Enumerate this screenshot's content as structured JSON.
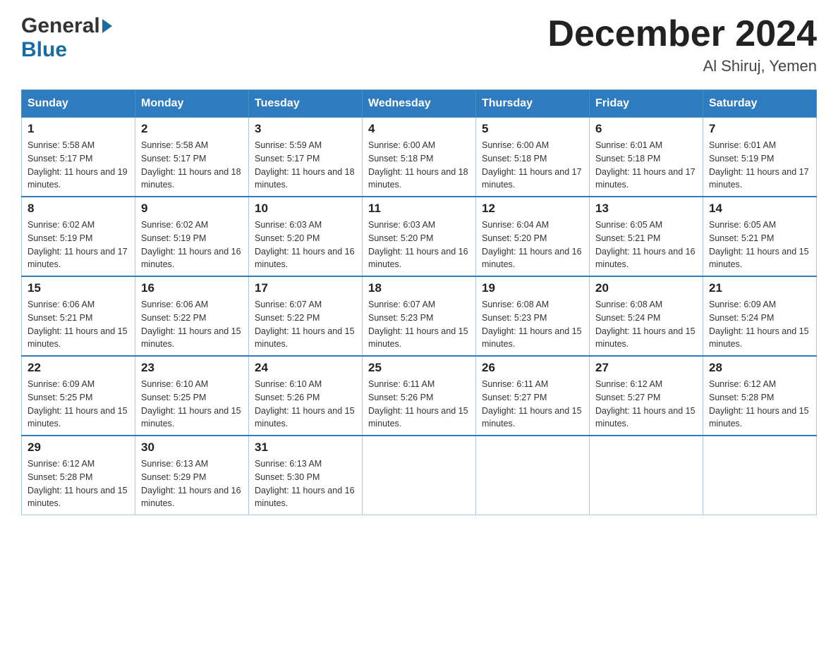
{
  "header": {
    "logo_general": "General",
    "logo_blue": "Blue",
    "title": "December 2024",
    "location": "Al Shiruj, Yemen"
  },
  "days_of_week": [
    "Sunday",
    "Monday",
    "Tuesday",
    "Wednesday",
    "Thursday",
    "Friday",
    "Saturday"
  ],
  "weeks": [
    [
      {
        "day": "1",
        "sunrise": "5:58 AM",
        "sunset": "5:17 PM",
        "daylight": "11 hours and 19 minutes."
      },
      {
        "day": "2",
        "sunrise": "5:58 AM",
        "sunset": "5:17 PM",
        "daylight": "11 hours and 18 minutes."
      },
      {
        "day": "3",
        "sunrise": "5:59 AM",
        "sunset": "5:17 PM",
        "daylight": "11 hours and 18 minutes."
      },
      {
        "day": "4",
        "sunrise": "6:00 AM",
        "sunset": "5:18 PM",
        "daylight": "11 hours and 18 minutes."
      },
      {
        "day": "5",
        "sunrise": "6:00 AM",
        "sunset": "5:18 PM",
        "daylight": "11 hours and 17 minutes."
      },
      {
        "day": "6",
        "sunrise": "6:01 AM",
        "sunset": "5:18 PM",
        "daylight": "11 hours and 17 minutes."
      },
      {
        "day": "7",
        "sunrise": "6:01 AM",
        "sunset": "5:19 PM",
        "daylight": "11 hours and 17 minutes."
      }
    ],
    [
      {
        "day": "8",
        "sunrise": "6:02 AM",
        "sunset": "5:19 PM",
        "daylight": "11 hours and 17 minutes."
      },
      {
        "day": "9",
        "sunrise": "6:02 AM",
        "sunset": "5:19 PM",
        "daylight": "11 hours and 16 minutes."
      },
      {
        "day": "10",
        "sunrise": "6:03 AM",
        "sunset": "5:20 PM",
        "daylight": "11 hours and 16 minutes."
      },
      {
        "day": "11",
        "sunrise": "6:03 AM",
        "sunset": "5:20 PM",
        "daylight": "11 hours and 16 minutes."
      },
      {
        "day": "12",
        "sunrise": "6:04 AM",
        "sunset": "5:20 PM",
        "daylight": "11 hours and 16 minutes."
      },
      {
        "day": "13",
        "sunrise": "6:05 AM",
        "sunset": "5:21 PM",
        "daylight": "11 hours and 16 minutes."
      },
      {
        "day": "14",
        "sunrise": "6:05 AM",
        "sunset": "5:21 PM",
        "daylight": "11 hours and 15 minutes."
      }
    ],
    [
      {
        "day": "15",
        "sunrise": "6:06 AM",
        "sunset": "5:21 PM",
        "daylight": "11 hours and 15 minutes."
      },
      {
        "day": "16",
        "sunrise": "6:06 AM",
        "sunset": "5:22 PM",
        "daylight": "11 hours and 15 minutes."
      },
      {
        "day": "17",
        "sunrise": "6:07 AM",
        "sunset": "5:22 PM",
        "daylight": "11 hours and 15 minutes."
      },
      {
        "day": "18",
        "sunrise": "6:07 AM",
        "sunset": "5:23 PM",
        "daylight": "11 hours and 15 minutes."
      },
      {
        "day": "19",
        "sunrise": "6:08 AM",
        "sunset": "5:23 PM",
        "daylight": "11 hours and 15 minutes."
      },
      {
        "day": "20",
        "sunrise": "6:08 AM",
        "sunset": "5:24 PM",
        "daylight": "11 hours and 15 minutes."
      },
      {
        "day": "21",
        "sunrise": "6:09 AM",
        "sunset": "5:24 PM",
        "daylight": "11 hours and 15 minutes."
      }
    ],
    [
      {
        "day": "22",
        "sunrise": "6:09 AM",
        "sunset": "5:25 PM",
        "daylight": "11 hours and 15 minutes."
      },
      {
        "day": "23",
        "sunrise": "6:10 AM",
        "sunset": "5:25 PM",
        "daylight": "11 hours and 15 minutes."
      },
      {
        "day": "24",
        "sunrise": "6:10 AM",
        "sunset": "5:26 PM",
        "daylight": "11 hours and 15 minutes."
      },
      {
        "day": "25",
        "sunrise": "6:11 AM",
        "sunset": "5:26 PM",
        "daylight": "11 hours and 15 minutes."
      },
      {
        "day": "26",
        "sunrise": "6:11 AM",
        "sunset": "5:27 PM",
        "daylight": "11 hours and 15 minutes."
      },
      {
        "day": "27",
        "sunrise": "6:12 AM",
        "sunset": "5:27 PM",
        "daylight": "11 hours and 15 minutes."
      },
      {
        "day": "28",
        "sunrise": "6:12 AM",
        "sunset": "5:28 PM",
        "daylight": "11 hours and 15 minutes."
      }
    ],
    [
      {
        "day": "29",
        "sunrise": "6:12 AM",
        "sunset": "5:28 PM",
        "daylight": "11 hours and 15 minutes."
      },
      {
        "day": "30",
        "sunrise": "6:13 AM",
        "sunset": "5:29 PM",
        "daylight": "11 hours and 16 minutes."
      },
      {
        "day": "31",
        "sunrise": "6:13 AM",
        "sunset": "5:30 PM",
        "daylight": "11 hours and 16 minutes."
      },
      null,
      null,
      null,
      null
    ]
  ],
  "labels": {
    "sunrise": "Sunrise:",
    "sunset": "Sunset:",
    "daylight": "Daylight:"
  }
}
